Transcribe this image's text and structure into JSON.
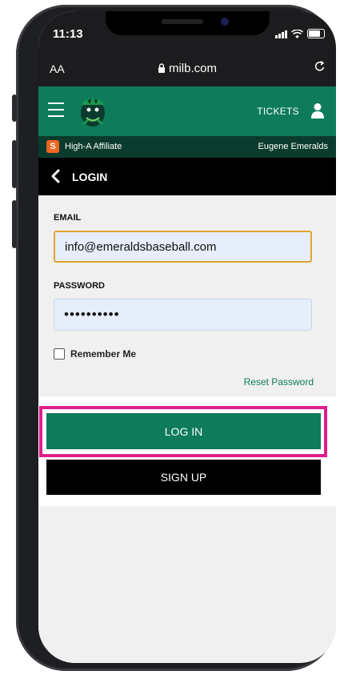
{
  "status_bar": {
    "time": "11:13"
  },
  "browser": {
    "text_size": "AA",
    "url": "milb.com"
  },
  "header": {
    "tickets_label": "TICKETS"
  },
  "affiliate": {
    "logo_letter": "S",
    "label": "High-A Affiliate",
    "team": "Eugene Emeralds"
  },
  "login_header": {
    "title": "LOGIN"
  },
  "form": {
    "email_label": "EMAIL",
    "email_value": "info@emeraldsbaseball.com",
    "password_label": "PASSWORD",
    "password_value": "••••••••••",
    "remember_label": "Remember Me",
    "reset_label": "Reset Password"
  },
  "buttons": {
    "login_label": "LOG IN",
    "signup_label": "SIGN UP"
  },
  "colors": {
    "brand_green": "#0e7b5b",
    "highlight": "#e01e8c",
    "input_focus": "#e0a530"
  }
}
